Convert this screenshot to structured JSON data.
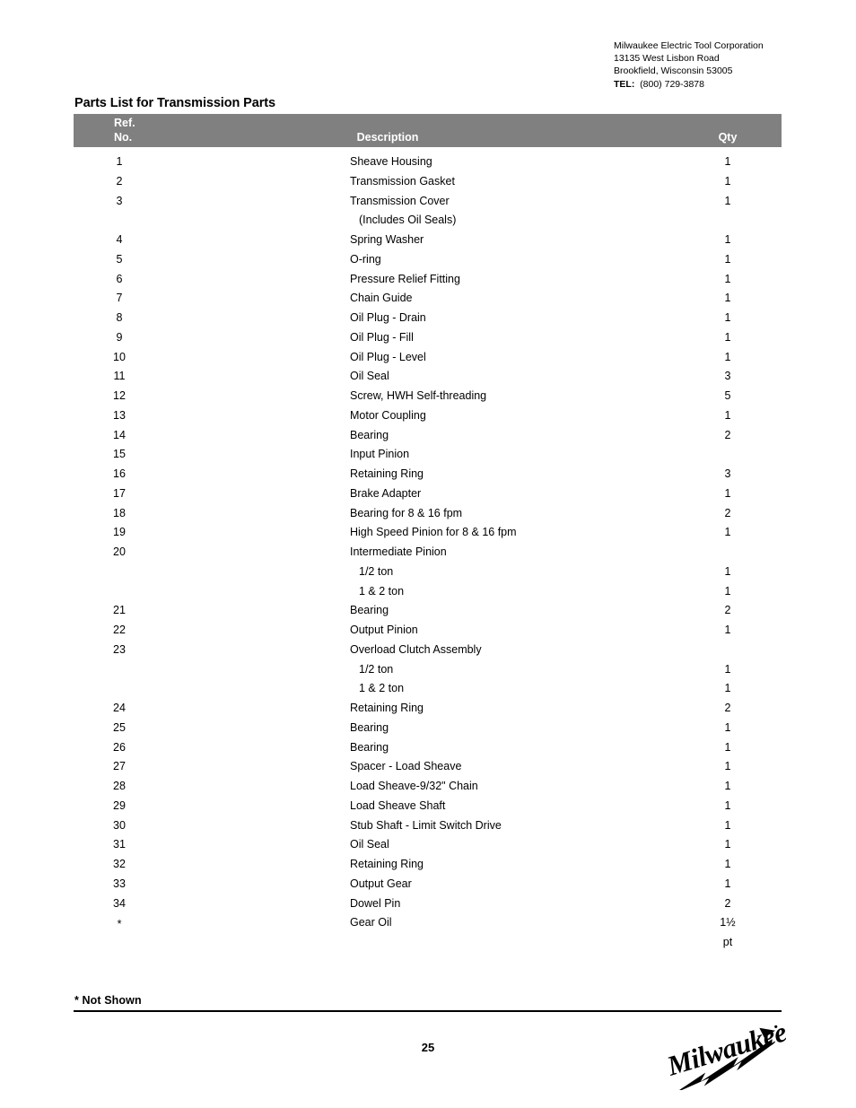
{
  "company": {
    "name": "Milwaukee Electric Tool Corporation",
    "address": "13135 West Lisbon Road",
    "city_state_zip": "Brookfield, Wisconsin 53005",
    "tel_label": "TEL:",
    "tel_number": "(800) 729-3878"
  },
  "page_title": "Parts List for Transmission Parts",
  "table": {
    "headers": {
      "ref_line1": "Ref.",
      "ref_line2": "No.",
      "description": "Description",
      "qty": "Qty"
    },
    "rows": [
      {
        "ref": "1",
        "desc": "Sheave Housing",
        "qty": "1",
        "sub": false
      },
      {
        "ref": "2",
        "desc": "Transmission Gasket",
        "qty": "1",
        "sub": false
      },
      {
        "ref": "3",
        "desc": "Transmission Cover",
        "qty": "1",
        "sub": false
      },
      {
        "ref": "",
        "desc": "(Includes Oil Seals)",
        "qty": "",
        "sub": true
      },
      {
        "ref": "4",
        "desc": "Spring Washer",
        "qty": "1",
        "sub": false
      },
      {
        "ref": "5",
        "desc": "O-ring",
        "qty": "1",
        "sub": false
      },
      {
        "ref": "6",
        "desc": "Pressure Relief Fitting",
        "qty": "1",
        "sub": false
      },
      {
        "ref": "7",
        "desc": "Chain Guide",
        "qty": "1",
        "sub": false
      },
      {
        "ref": "8",
        "desc": "Oil Plug - Drain",
        "qty": "1",
        "sub": false
      },
      {
        "ref": "9",
        "desc": "Oil Plug - Fill",
        "qty": "1",
        "sub": false
      },
      {
        "ref": "10",
        "desc": "Oil Plug - Level",
        "qty": "1",
        "sub": false
      },
      {
        "ref": "11",
        "desc": "Oil Seal",
        "qty": "3",
        "sub": false
      },
      {
        "ref": "12",
        "desc": "Screw, HWH Self-threading",
        "qty": "5",
        "sub": false
      },
      {
        "ref": "13",
        "desc": "Motor Coupling",
        "qty": "1",
        "sub": false
      },
      {
        "ref": "14",
        "desc": "Bearing",
        "qty": "2",
        "sub": false
      },
      {
        "ref": "15",
        "desc": "Input Pinion",
        "qty": "",
        "sub": false
      },
      {
        "ref": "16",
        "desc": "Retaining Ring",
        "qty": "3",
        "sub": false
      },
      {
        "ref": "17",
        "desc": "Brake Adapter",
        "qty": "1",
        "sub": false
      },
      {
        "ref": "18",
        "desc": "Bearing for 8 & 16 fpm",
        "qty": "2",
        "sub": false
      },
      {
        "ref": "19",
        "desc": "High Speed Pinion for 8 & 16 fpm",
        "qty": "1",
        "sub": false
      },
      {
        "ref": "20",
        "desc": "Intermediate Pinion",
        "qty": "",
        "sub": false
      },
      {
        "ref": "",
        "desc": "1/2 ton",
        "qty": "1",
        "sub": true
      },
      {
        "ref": "",
        "desc": "1 & 2 ton",
        "qty": "1",
        "sub": true
      },
      {
        "ref": "21",
        "desc": "Bearing",
        "qty": "2",
        "sub": false
      },
      {
        "ref": "22",
        "desc": "Output Pinion",
        "qty": "1",
        "sub": false
      },
      {
        "ref": "23",
        "desc": "Overload Clutch Assembly",
        "qty": "",
        "sub": false
      },
      {
        "ref": "",
        "desc": "1/2 ton",
        "qty": "1",
        "sub": true
      },
      {
        "ref": "",
        "desc": "1 & 2 ton",
        "qty": "1",
        "sub": true
      },
      {
        "ref": "24",
        "desc": "Retaining Ring",
        "qty": "2",
        "sub": false
      },
      {
        "ref": "25",
        "desc": "Bearing",
        "qty": "1",
        "sub": false
      },
      {
        "ref": "26",
        "desc": "Bearing",
        "qty": "1",
        "sub": false
      },
      {
        "ref": "27",
        "desc": "Spacer - Load Sheave",
        "qty": "1",
        "sub": false
      },
      {
        "ref": "28",
        "desc": "Load Sheave-9/32\" Chain",
        "qty": "1",
        "sub": false
      },
      {
        "ref": "29",
        "desc": "Load Sheave Shaft",
        "qty": "1",
        "sub": false
      },
      {
        "ref": "30",
        "desc": "Stub Shaft - Limit Switch Drive",
        "qty": "1",
        "sub": false
      },
      {
        "ref": "31",
        "desc": "Oil Seal",
        "qty": "1",
        "sub": false
      },
      {
        "ref": "32",
        "desc": "Retaining Ring",
        "qty": "1",
        "sub": false
      },
      {
        "ref": "33",
        "desc": "Output Gear",
        "qty": "1",
        "sub": false
      },
      {
        "ref": "34",
        "desc": "Dowel Pin",
        "qty": "2",
        "sub": false
      },
      {
        "ref": "*",
        "desc": "Gear Oil",
        "qty": "1½",
        "sub": false
      },
      {
        "ref": "",
        "desc": "",
        "qty": "pt",
        "sub": false
      }
    ]
  },
  "footnote": "* Not Shown",
  "page_number": "25",
  "logo": {
    "wordmark": "Milwaukee"
  },
  "colors": {
    "header_bar": "#808080",
    "header_text": "#ffffff",
    "body_text": "#000000",
    "rule": "#000000"
  }
}
